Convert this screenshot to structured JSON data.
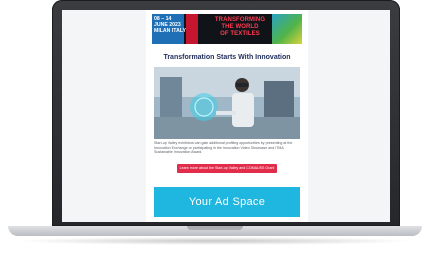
{
  "banner": {
    "start_day": "08",
    "end_day": "14",
    "month_year": "JUNE 2023",
    "location": "MILAN ITALY",
    "tagline_line1": "TRANSFORMING",
    "tagline_line2": "THE WORLD",
    "tagline_line3": "OF TEXTILES"
  },
  "email": {
    "headline": "Transformation Starts With Innovation",
    "body": "Start-up Valley exhibitors can gain additional profiling opportunities by presenting at the Innovation Exchange or participating in the Innovation Video Showcase and ITMA Sustainable Innovation Award.",
    "cta_label": "Learn more about the Start-up Valley and COMAUSS Grant",
    "ad_label": "Your Ad Space"
  },
  "colors": {
    "cta": "#e12d4b",
    "ad": "#1fb6e0",
    "headline": "#1f2d5b"
  }
}
